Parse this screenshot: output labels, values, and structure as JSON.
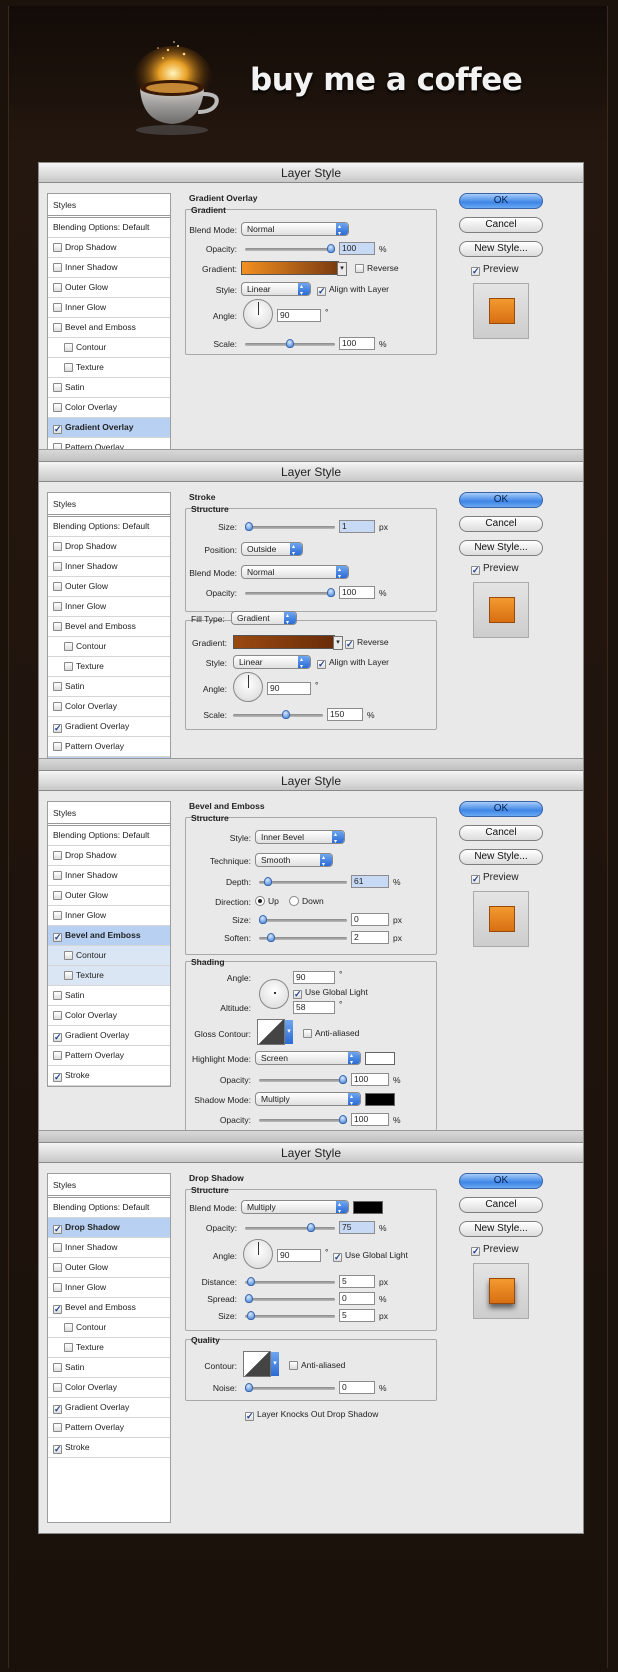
{
  "brand": {
    "title": "buy me a coffee"
  },
  "dialog_title": "Layer Style",
  "buttons": {
    "ok": "OK",
    "cancel": "Cancel",
    "new_style": "New Style...",
    "preview": "Preview"
  },
  "sidebar": {
    "styles": "Styles",
    "blending": "Blending Options: Default",
    "items": [
      "Drop Shadow",
      "Inner Shadow",
      "Outer Glow",
      "Inner Glow",
      "Bevel and Emboss",
      "Contour",
      "Texture",
      "Satin",
      "Color Overlay",
      "Gradient Overlay",
      "Pattern Overlay",
      "Stroke"
    ]
  },
  "panels": [
    {
      "checked": [
        false,
        false,
        false,
        false,
        false,
        false,
        false,
        false,
        false,
        true,
        false,
        false
      ],
      "selected": 9,
      "section": "Gradient Overlay",
      "group": "Gradient",
      "labels": {
        "blend_mode": "Blend Mode:",
        "opacity": "Opacity:",
        "gradient": "Gradient:",
        "reverse": "Reverse",
        "style": "Style:",
        "align": "Align with Layer",
        "angle": "Angle:",
        "scale": "Scale:",
        "pct": "%",
        "deg": "°"
      },
      "values": {
        "blend_mode": "Normal",
        "opacity": "100",
        "opacity_level": 1.0,
        "style": "Linear",
        "angle": "90",
        "scale": "100",
        "scale_level": 0.5,
        "reverse": false,
        "align": true
      },
      "gradient_colors": [
        "#f39020",
        "#7a3a10"
      ]
    },
    {
      "checked": [
        false,
        false,
        false,
        false,
        false,
        false,
        false,
        false,
        false,
        true,
        false,
        true
      ],
      "selected": 11,
      "section": "Stroke",
      "group": "Structure",
      "fill_label": "Fill Type:",
      "labels": {
        "size": "Size:",
        "px": "px",
        "position": "Position:",
        "blend_mode": "Blend Mode:",
        "opacity": "Opacity:",
        "gradient": "Gradient:",
        "reverse": "Reverse",
        "style": "Style:",
        "align": "Align with Layer",
        "angle": "Angle:",
        "scale": "Scale:",
        "pct": "%",
        "deg": "°"
      },
      "values": {
        "size": "1",
        "size_level": 0.0,
        "position": "Outside",
        "blend_mode": "Normal",
        "opacity": "100",
        "opacity_level": 1.0,
        "fill_type": "Gradient",
        "style": "Linear",
        "angle": "90",
        "scale": "150",
        "scale_level": 0.6,
        "reverse": true,
        "align": true
      },
      "gradient_colors": [
        "#9a4a12",
        "#6a2c08"
      ]
    },
    {
      "checked": [
        false,
        false,
        false,
        false,
        true,
        false,
        false,
        false,
        false,
        true,
        false,
        true
      ],
      "selected": 4,
      "section": "Bevel and Emboss",
      "group": "Structure",
      "shading_group": "Shading",
      "labels": {
        "style": "Style:",
        "technique": "Technique:",
        "depth": "Depth:",
        "direction": "Direction:",
        "up": "Up",
        "down": "Down",
        "size": "Size:",
        "soften": "Soften:",
        "angle": "Angle:",
        "global_light": "Use Global Light",
        "altitude": "Altitude:",
        "gloss": "Gloss Contour:",
        "anti": "Anti-aliased",
        "highlight": "Highlight Mode:",
        "opacity": "Opacity:",
        "shadow": "Shadow Mode:",
        "pct": "%",
        "px": "px",
        "deg": "°"
      },
      "values": {
        "style": "Inner Bevel",
        "technique": "Smooth",
        "depth": "61",
        "depth_level": 0.06,
        "size": "0",
        "size_level": 0.0,
        "soften": "2",
        "soften_level": 0.1,
        "angle": "90",
        "altitude": "58",
        "highlight": "Screen",
        "highlight_opacity": "100",
        "highlight_level": 1.0,
        "shadow": "Multiply",
        "shadow_opacity": "100",
        "shadow_level": 1.0,
        "direction_up": true,
        "global_light": true,
        "anti_aliased": false
      },
      "highlight_color": "#ffffff",
      "shadow_color": "#000000"
    },
    {
      "checked": [
        true,
        false,
        false,
        false,
        true,
        false,
        false,
        false,
        false,
        true,
        false,
        true
      ],
      "selected": 0,
      "section": "Drop Shadow",
      "group": "Structure",
      "quality_group": "Quality",
      "labels": {
        "blend_mode": "Blend Mode:",
        "opacity": "Opacity:",
        "angle": "Angle:",
        "global_light": "Use Global Light",
        "distance": "Distance:",
        "spread": "Spread:",
        "size": "Size:",
        "contour": "Contour:",
        "anti": "Anti-aliased",
        "noise": "Noise:",
        "knocks": "Layer Knocks Out Drop Shadow",
        "pct": "%",
        "px": "px",
        "deg": "°"
      },
      "values": {
        "blend_mode": "Multiply",
        "opacity": "75",
        "opacity_level": 0.75,
        "angle": "90",
        "distance": "5",
        "distance_level": 0.03,
        "spread": "0",
        "spread_level": 0.0,
        "size": "5",
        "size_level": 0.03,
        "noise": "0",
        "noise_level": 0.0,
        "global_light": true,
        "anti_aliased": false,
        "knocks": true
      },
      "shadow_color": "#000000"
    }
  ]
}
